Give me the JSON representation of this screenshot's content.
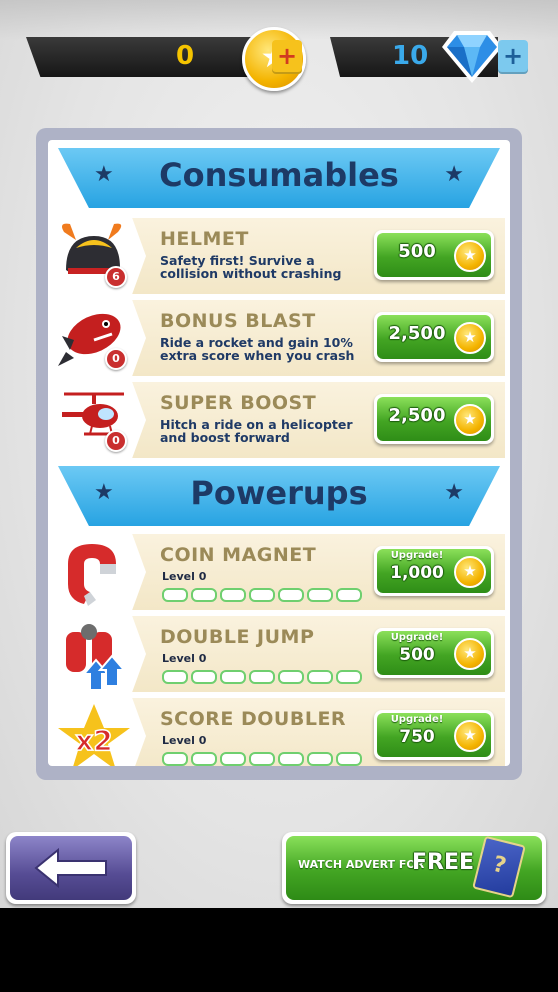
{
  "currency": {
    "coins": {
      "value": "0",
      "plus": "+"
    },
    "gems": {
      "value": "10",
      "plus": "+"
    }
  },
  "sections": {
    "consumables": {
      "title": "Consumables"
    },
    "powerups": {
      "title": "Powerups"
    }
  },
  "consumables": [
    {
      "name": "HELMET",
      "desc": "Safety first! Survive a collision without crashing",
      "count": "6",
      "price": "500"
    },
    {
      "name": "BONUS BLAST",
      "desc": "Ride a rocket and gain 10% extra score when you crash",
      "count": "0",
      "price": "2,500"
    },
    {
      "name": "SUPER BOOST",
      "desc": "Hitch a ride on a helicopter and boost forward",
      "count": "0",
      "price": "2,500"
    }
  ],
  "powerups": [
    {
      "name": "COIN MAGNET",
      "level": "Level 0",
      "upgrade": "Upgrade!",
      "price": "1,000",
      "level_progress": 0
    },
    {
      "name": "DOUBLE JUMP",
      "level": "Level 0",
      "upgrade": "Upgrade!",
      "price": "500",
      "level_progress": 0
    },
    {
      "name": "SCORE DOUBLER",
      "level": "Level 0",
      "upgrade": "Upgrade!",
      "price": "750",
      "level_progress": 0
    }
  ],
  "footer": {
    "back_icon": "left-arrow-icon",
    "watch_label": "WATCH ADVERT FOR",
    "free_label": "FREE",
    "card_symbol": "?"
  },
  "colors": {
    "buy_green": "#43a523",
    "banner_blue": "#27a3e2",
    "title_navy": "#1d3a66",
    "item_gold": "#9b8a58",
    "back_purple": "#564c94"
  }
}
